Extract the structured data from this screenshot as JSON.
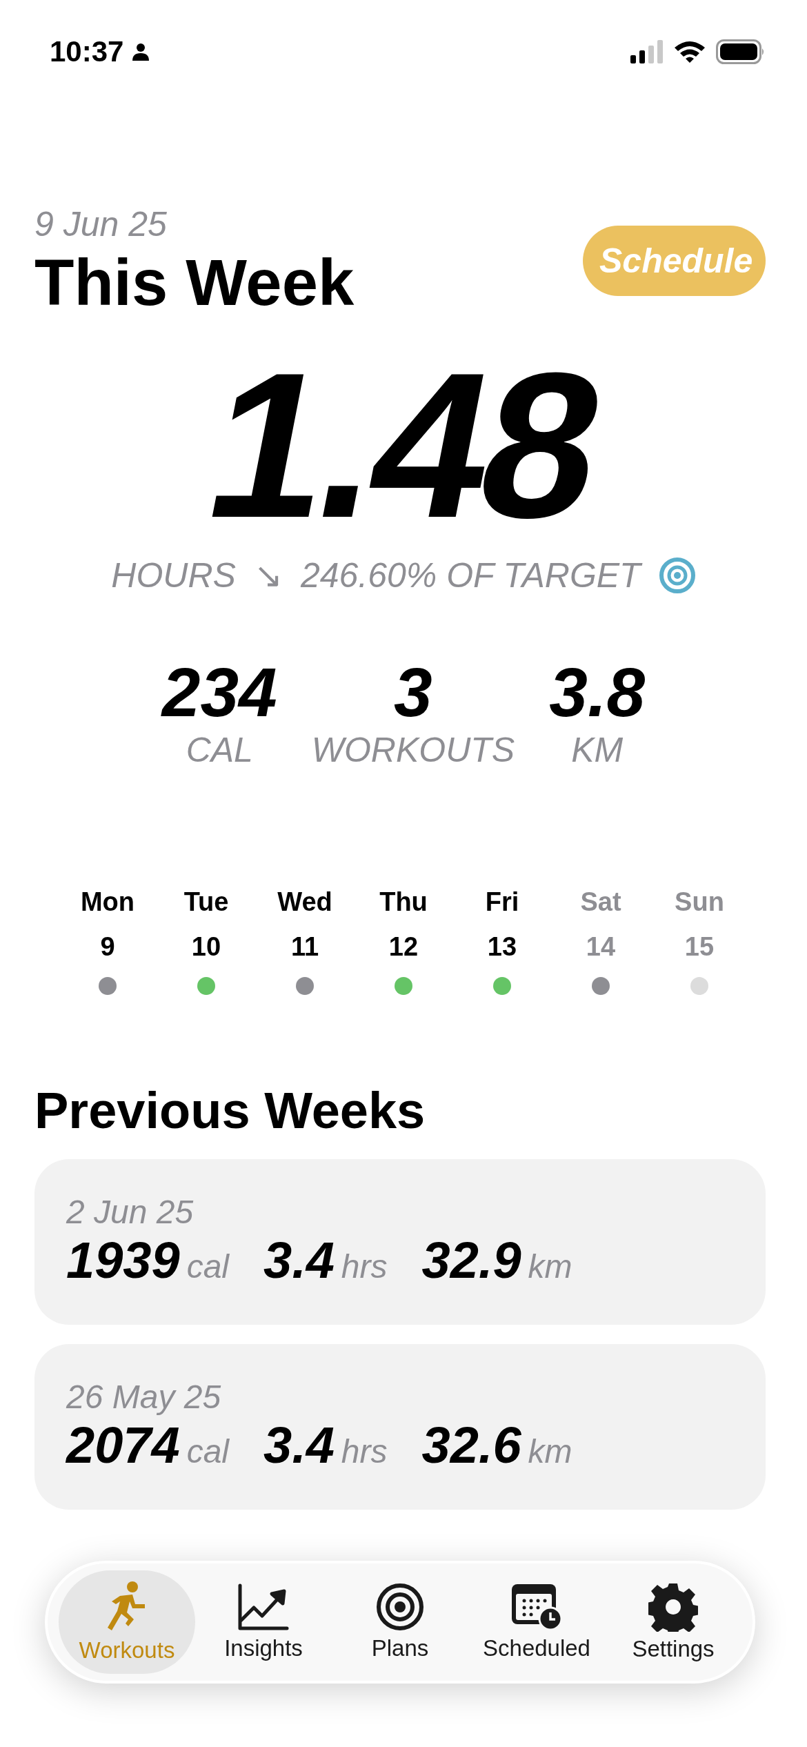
{
  "status_bar": {
    "time": "10:37"
  },
  "header": {
    "date": "9 Jun 25",
    "title": "This Week",
    "schedule_button": "Schedule"
  },
  "hours": {
    "value": "1.48",
    "label": "HOURS",
    "trend": "↘",
    "target": "246.60% OF TARGET"
  },
  "stats": [
    {
      "value": "234",
      "label": "CAL"
    },
    {
      "value": "3",
      "label": "WORKOUTS"
    },
    {
      "value": "3.8",
      "label": "KM"
    }
  ],
  "days": [
    {
      "name": "Mon",
      "date": "9",
      "dimmed": false,
      "color": "#8e8e93"
    },
    {
      "name": "Tue",
      "date": "10",
      "dimmed": false,
      "color": "#65c466"
    },
    {
      "name": "Wed",
      "date": "11",
      "dimmed": false,
      "color": "#8e8e93"
    },
    {
      "name": "Thu",
      "date": "12",
      "dimmed": false,
      "color": "#65c466"
    },
    {
      "name": "Fri",
      "date": "13",
      "dimmed": false,
      "color": "#65c466"
    },
    {
      "name": "Sat",
      "date": "14",
      "dimmed": true,
      "color": "#8e8e93"
    },
    {
      "name": "Sun",
      "date": "15",
      "dimmed": true,
      "color": "#dcdcdc"
    }
  ],
  "previous_weeks": {
    "title": "Previous Weeks",
    "cards": [
      {
        "date": "2 Jun 25",
        "metrics": [
          {
            "value": "1939",
            "unit": "cal"
          },
          {
            "value": "3.4",
            "unit": "hrs"
          },
          {
            "value": "32.9",
            "unit": "km"
          }
        ]
      },
      {
        "date": "26 May 25",
        "metrics": [
          {
            "value": "2074",
            "unit": "cal"
          },
          {
            "value": "3.4",
            "unit": "hrs"
          },
          {
            "value": "32.6",
            "unit": "km"
          }
        ]
      }
    ]
  },
  "tab_bar": [
    {
      "label": "Workouts",
      "kind": "run",
      "selected": true
    },
    {
      "label": "Insights",
      "kind": "chart",
      "selected": false
    },
    {
      "label": "Plans",
      "kind": "target",
      "selected": false
    },
    {
      "label": "Scheduled",
      "kind": "calendar",
      "selected": false
    },
    {
      "label": "Settings",
      "kind": "gear",
      "selected": false
    }
  ]
}
